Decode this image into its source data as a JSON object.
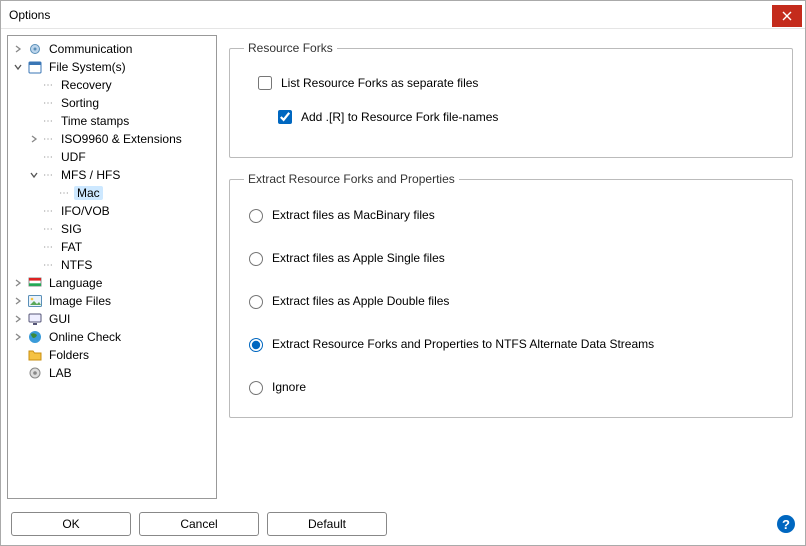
{
  "window": {
    "title": "Options"
  },
  "tree": {
    "items": [
      {
        "label": "Communication",
        "icon": "gear-users",
        "expandable": true,
        "expanded": false
      },
      {
        "label": "File System(s)",
        "icon": "calendar",
        "expandable": true,
        "expanded": true,
        "children": [
          {
            "label": "Recovery"
          },
          {
            "label": "Sorting"
          },
          {
            "label": "Time stamps"
          },
          {
            "label": "ISO9960 & Extensions",
            "expandable": true,
            "expanded": false
          },
          {
            "label": "UDF"
          },
          {
            "label": "MFS / HFS",
            "expandable": true,
            "expanded": true,
            "children": [
              {
                "label": "Mac",
                "selected": true
              }
            ]
          },
          {
            "label": "IFO/VOB"
          },
          {
            "label": "SIG"
          },
          {
            "label": "FAT"
          },
          {
            "label": "NTFS"
          }
        ]
      },
      {
        "label": "Language",
        "icon": "flag",
        "expandable": true,
        "expanded": false
      },
      {
        "label": "Image Files",
        "icon": "image",
        "expandable": true,
        "expanded": false
      },
      {
        "label": "GUI",
        "icon": "monitor",
        "expandable": true,
        "expanded": false
      },
      {
        "label": "Online Check",
        "icon": "globe",
        "expandable": true,
        "expanded": false
      },
      {
        "label": "Folders",
        "icon": "folder",
        "expandable": false
      },
      {
        "label": "LAB",
        "icon": "gear",
        "expandable": false
      }
    ]
  },
  "panel": {
    "group1": {
      "legend": "Resource Forks",
      "chk_list": {
        "label": "List Resource Forks as separate files",
        "checked": false
      },
      "chk_add_r": {
        "label": "Add .[R] to Resource Fork file-names",
        "checked": true
      }
    },
    "group2": {
      "legend": "Extract Resource Forks and Properties",
      "options": [
        "Extract files as MacBinary files",
        "Extract files as Apple Single files",
        "Extract files as Apple Double files",
        "Extract Resource Forks and Properties to NTFS Alternate Data Streams",
        "Ignore"
      ],
      "selected_index": 3
    }
  },
  "buttons": {
    "ok": "OK",
    "cancel": "Cancel",
    "default": "Default"
  }
}
